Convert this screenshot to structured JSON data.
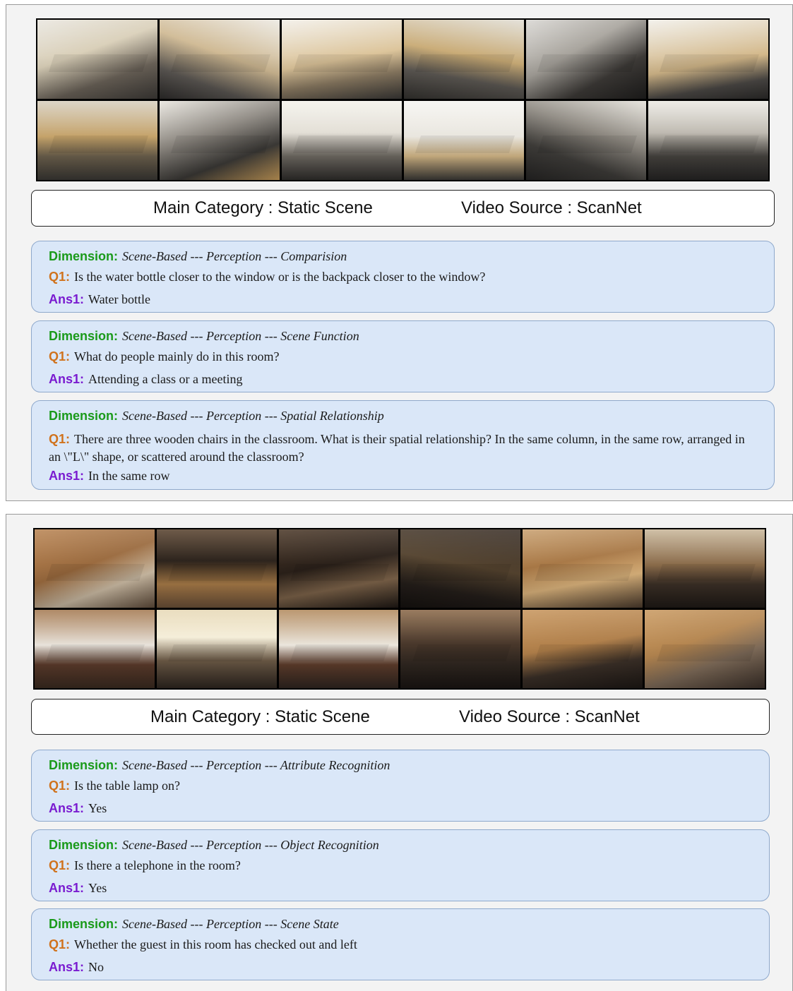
{
  "panels": [
    {
      "main_category_text": "Main Category : Static Scene",
      "video_source_text": "Video Source : ScanNet",
      "qa": [
        {
          "dimension_label": "Dimension:",
          "dimension": "Scene-Based --- Perception --- Comparision",
          "q_label": "Q1:",
          "question": "Is the water bottle closer to the window or is the backpack closer to the window?",
          "ans_label": "Ans1:",
          "answer": "Water bottle"
        },
        {
          "dimension_label": "Dimension:",
          "dimension": "Scene-Based --- Perception --- Scene Function",
          "q_label": "Q1:",
          "question": "What do people mainly do in this room?",
          "ans_label": "Ans1:",
          "answer": "Attending a class or a meeting"
        },
        {
          "dimension_label": "Dimension:",
          "dimension": "Scene-Based --- Perception --- Spatial Relationship",
          "q_label": "Q1:",
          "question": "There are three wooden chairs in the classroom. What is their spatial relationship? In the same column, in the same row, arranged in an \\\"L\\\" shape, or scattered around the classroom?",
          "ans_label": "Ans1:",
          "answer": "In the same row"
        }
      ]
    },
    {
      "main_category_text": "Main Category : Static Scene",
      "video_source_text": "Video Source : ScanNet",
      "qa": [
        {
          "dimension_label": "Dimension:",
          "dimension": "Scene-Based --- Perception --- Attribute Recognition",
          "q_label": "Q1:",
          "question": "Is the table lamp on?",
          "ans_label": "Ans1:",
          "answer": "Yes"
        },
        {
          "dimension_label": "Dimension:",
          "dimension": "Scene-Based --- Perception --- Object Recognition",
          "q_label": "Q1:",
          "question": "Is there a telephone in the room?",
          "ans_label": "Ans1:",
          "answer": "Yes"
        },
        {
          "dimension_label": "Dimension:",
          "dimension": "Scene-Based --- Perception --- Scene State",
          "q_label": "Q1:",
          "question": "Whether the guest in this room has checked out and left",
          "ans_label": "Ans1:",
          "answer": "No"
        }
      ]
    }
  ]
}
